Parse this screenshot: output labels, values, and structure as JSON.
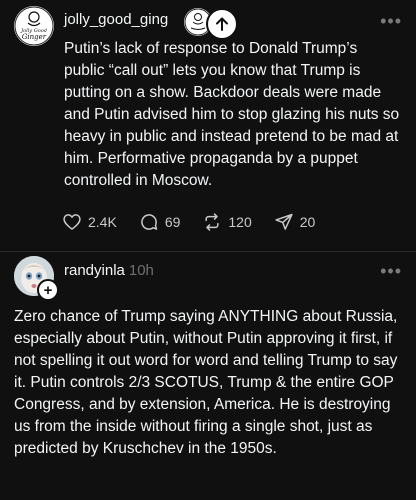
{
  "post1": {
    "username": "jolly_good_ging",
    "avatar_text": [
      "Jolly Good",
      "Ginger"
    ],
    "text": "Putin’s lack of response to Donald Trump’s public “call out” lets you know that Trump is putting on a show. Backdoor deals were made and Putin advised him to stop glazing his nuts so heavy in public and instead pretend to be mad at him. Performative propaganda by a puppet controlled in Moscow.",
    "likes": "2.4K",
    "comments": "69",
    "reposts": "120",
    "shares": "20"
  },
  "post2": {
    "username": "randyinla",
    "timestamp": "10h",
    "text": "Zero chance of Trump saying ANYTHING about Russia, especially about Putin, without Putin approving it first, if not spelling it out word for word and telling Trump to say it. Putin controls 2/3 SCOTUS, Trump & the entire GOP Congress, and by extension, America. He is destroying us from the inside without firing a single shot, just as predicted by Kruschchev in the 1950s.",
    "plus_symbol": "+"
  },
  "more_symbol": "•••",
  "icons": {
    "follow": "arrow-up-icon",
    "like": "heart-icon",
    "comment": "comment-icon",
    "repost": "repost-icon",
    "share": "send-icon"
  },
  "colors": {
    "background": "#101010",
    "text": "#f3f5f7",
    "muted": "#6f6f6f"
  }
}
